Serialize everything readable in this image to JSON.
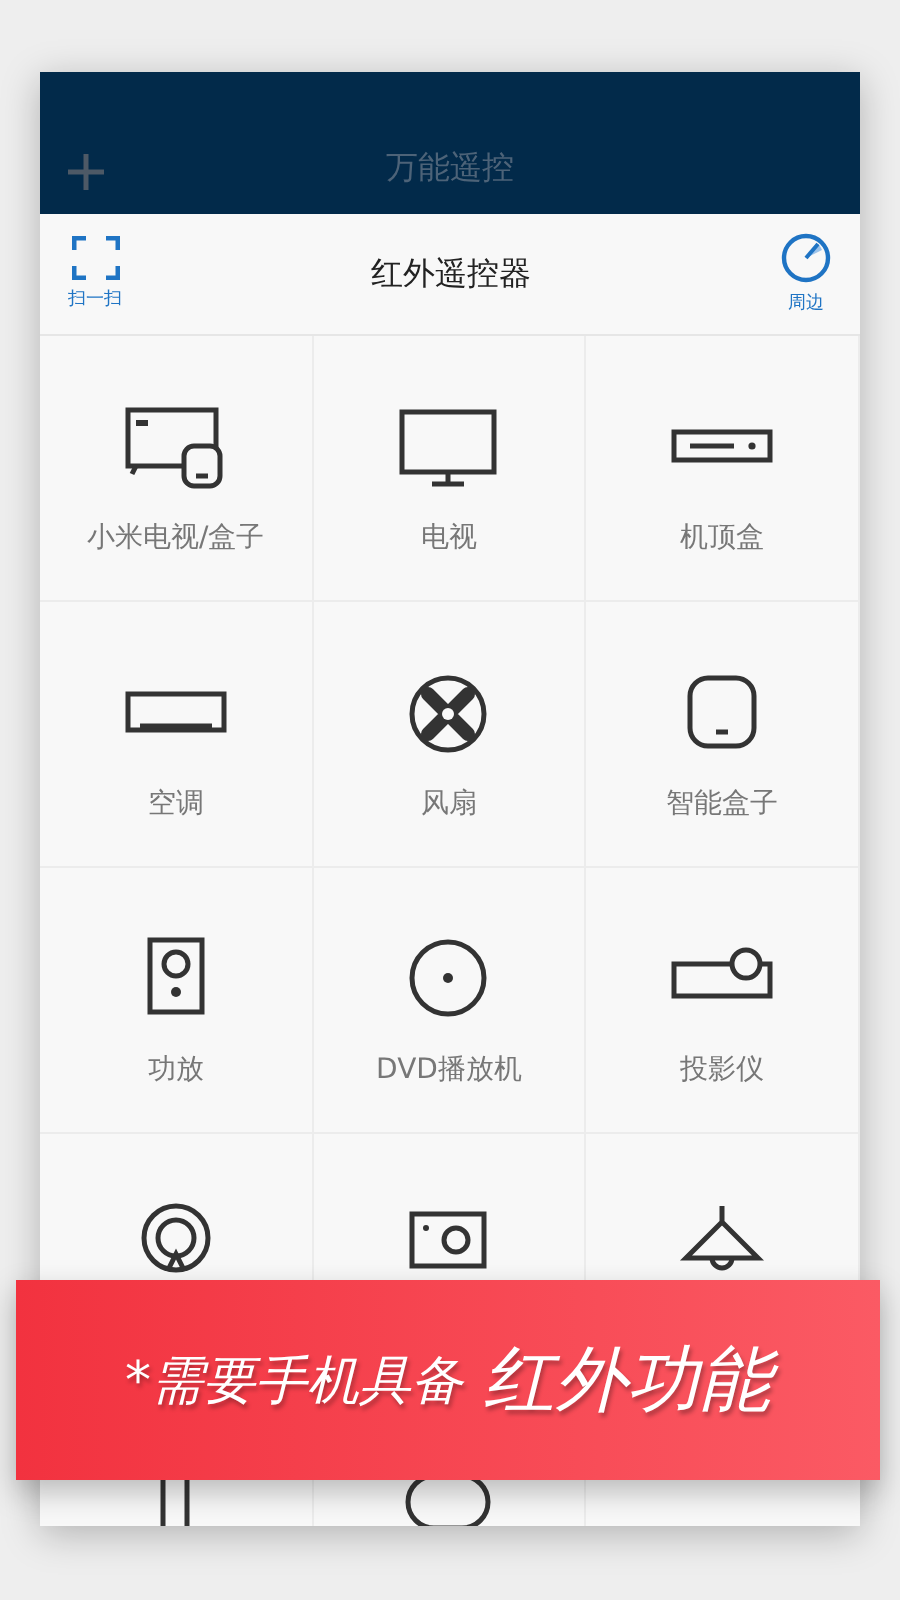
{
  "header": {
    "title": "万能遥控"
  },
  "toolbar": {
    "scan_label": "扫一扫",
    "title": "红外遥控器",
    "nearby_label": "周边"
  },
  "devices": [
    {
      "kind": "mi_tv",
      "label": "小米电视/盒子"
    },
    {
      "kind": "tv",
      "label": "电视"
    },
    {
      "kind": "settop",
      "label": "机顶盒"
    },
    {
      "kind": "ac",
      "label": "空调"
    },
    {
      "kind": "fan",
      "label": "风扇"
    },
    {
      "kind": "smartbox",
      "label": "智能盒子"
    },
    {
      "kind": "speaker",
      "label": "功放"
    },
    {
      "kind": "dvd",
      "label": "DVD播放机"
    },
    {
      "kind": "projector",
      "label": "投影仪"
    },
    {
      "kind": "pin"
    },
    {
      "kind": "camera"
    },
    {
      "kind": "lamp"
    },
    {
      "kind": "stand"
    },
    {
      "kind": "round"
    }
  ],
  "banner": {
    "prefix": "*需要手机具备",
    "emphasis": "红外功能"
  }
}
